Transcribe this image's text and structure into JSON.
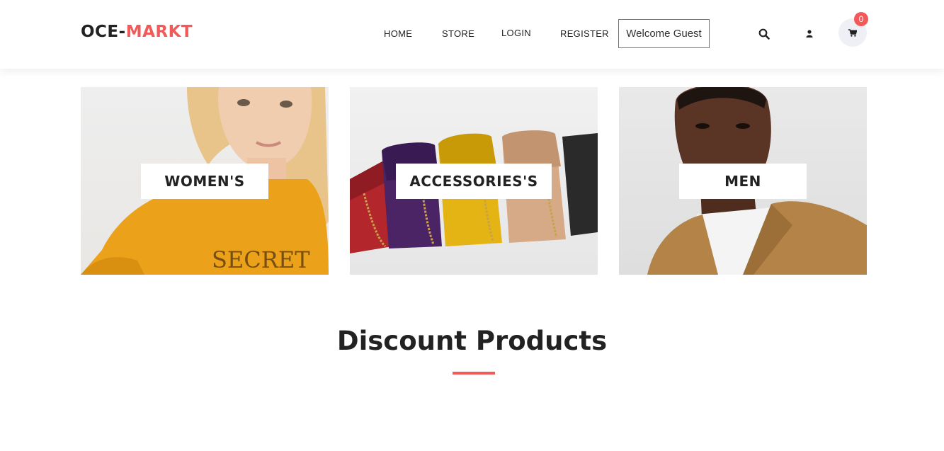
{
  "brand": {
    "part1": "OCE-",
    "part2": "MARKT",
    "accent_color": "#f15a59"
  },
  "nav": {
    "home": "HOME",
    "store": "STORE",
    "login": "LOGIN",
    "register": "REGISTER"
  },
  "welcome": "Welcome Guest",
  "icons": {
    "search": "search-icon",
    "user": "user-icon",
    "cart": "cart-icon"
  },
  "cart": {
    "count": "0"
  },
  "categories": [
    {
      "label": "WOMEN'S"
    },
    {
      "label": "ACCESSORIES'S"
    },
    {
      "label": "MEN"
    }
  ],
  "section": {
    "title": "Discount Products"
  }
}
